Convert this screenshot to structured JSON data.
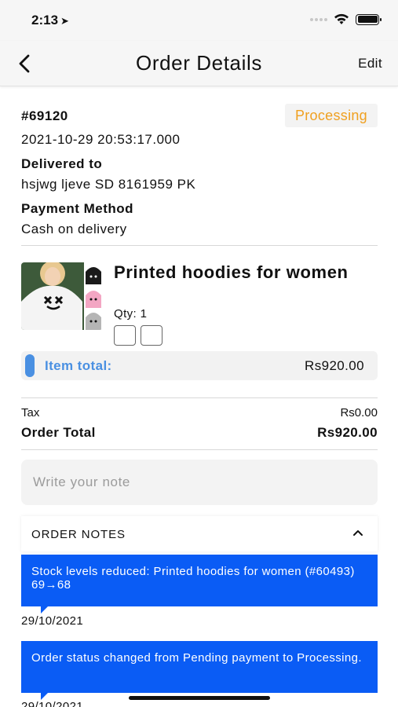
{
  "status_bar": {
    "time": "2:13",
    "location_glyph": "➤"
  },
  "nav": {
    "title": "Order Details",
    "edit_label": "Edit"
  },
  "order": {
    "id": "#69120",
    "status": "Processing",
    "status_color": "#f0a020",
    "datetime": "2021-10-29 20:53:17.000",
    "delivered_to_label": "Delivered to",
    "delivered_to": "hsjwg ljeve SD 8161959 PK",
    "payment_label": "Payment Method",
    "payment": "Cash on delivery"
  },
  "item": {
    "name": "Printed hoodies for women",
    "qty_text": "Qty: 1",
    "total_label": "Item total:",
    "total_value": "Rs920.00"
  },
  "summary": {
    "tax_label": "Tax",
    "tax_value": "Rs0.00",
    "order_total_label": "Order Total",
    "order_total_value": "Rs920.00"
  },
  "note_input": {
    "placeholder": "Write your note"
  },
  "notes": {
    "header": "ORDER NOTES",
    "items": [
      {
        "text": "Stock levels reduced: Printed hoodies for women (#60493) 69→68",
        "date": "29/10/2021"
      },
      {
        "text": "Order status changed from Pending payment to Processing.",
        "date": "29/10/2021"
      }
    ]
  },
  "colors": {
    "accent": "#4a90e2",
    "note_bg": "#0a5cf5"
  }
}
